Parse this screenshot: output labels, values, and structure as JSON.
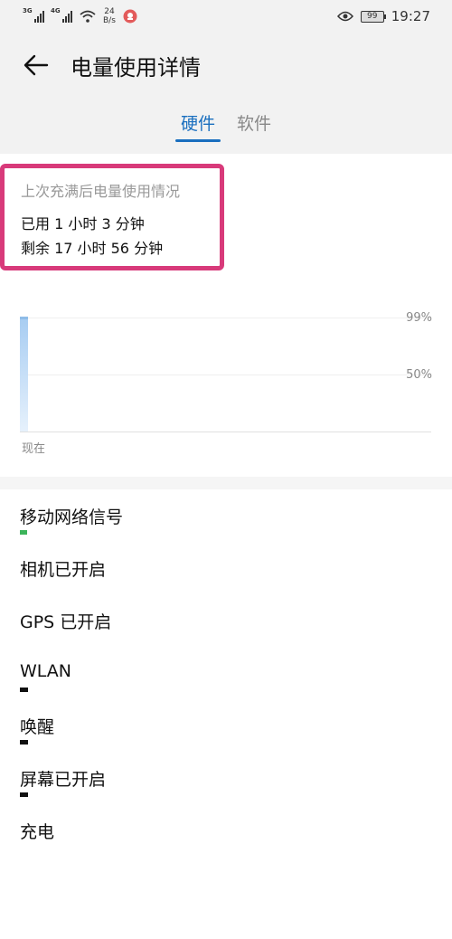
{
  "status_bar": {
    "sim1": "3G",
    "sim2": "4G",
    "net_speed_value": "24",
    "net_speed_unit": "B/s",
    "battery_level": "99",
    "time": "19:27"
  },
  "header": {
    "title": "电量使用详情"
  },
  "tabs": [
    {
      "label": "硬件",
      "active": true
    },
    {
      "label": "软件",
      "active": false
    }
  ],
  "summary": {
    "title": "上次充满后电量使用情况",
    "used": "已用 1 小时 3 分钟",
    "remaining": "剩余 17 小时 56 分钟"
  },
  "chart_data": {
    "type": "area",
    "y_tick_labels": [
      "99%",
      "50%"
    ],
    "x_tick_labels": [
      "现在"
    ],
    "ylim": [
      0,
      100
    ],
    "values": [
      99
    ],
    "grid": true
  },
  "hardware_items": [
    {
      "label": "移动网络信号",
      "usage_mark": "green"
    },
    {
      "label": "相机已开启",
      "usage_mark": "none"
    },
    {
      "label": "GPS 已开启",
      "usage_mark": "none"
    },
    {
      "label": "WLAN",
      "usage_mark": "black"
    },
    {
      "label": "唤醒",
      "usage_mark": "black"
    },
    {
      "label": "屏幕已开启",
      "usage_mark": "black"
    },
    {
      "label": "充电",
      "usage_mark": "none"
    }
  ],
  "colors": {
    "accent": "#1a6fbf",
    "highlight_border": "#d83a7a"
  }
}
